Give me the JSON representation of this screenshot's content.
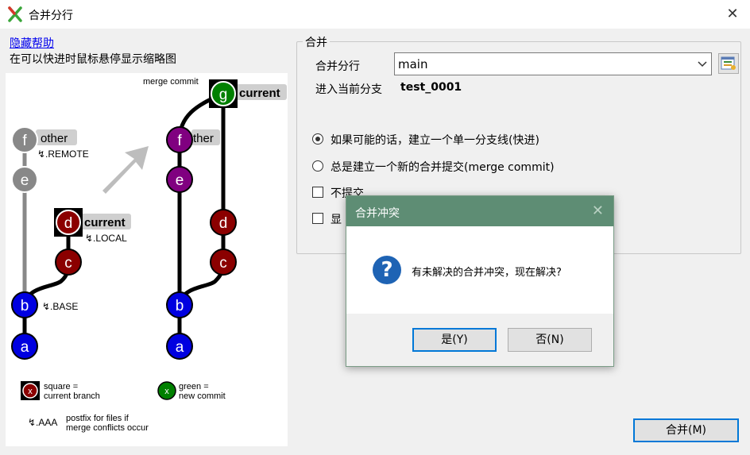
{
  "window": {
    "title": "合并分行",
    "close": "✕"
  },
  "help": {
    "hide_link": "隐藏帮助",
    "hint": "在可以快进时鼠标悬停显示缩略图"
  },
  "diagram": {
    "merge_commit_label": "merge commit",
    "commits_left": [
      "f",
      "e",
      "d",
      "c",
      "b",
      "a"
    ],
    "commits_right": [
      "g",
      "f",
      "e",
      "d",
      "c",
      "b",
      "a"
    ],
    "tag_other": "other",
    "tag_remote": "↯.REMOTE",
    "tag_current": "current",
    "tag_local": "↯.LOCAL",
    "tag_base": "↯.BASE",
    "tag_other_right": "ther",
    "legend_square_1": "square =",
    "legend_square_2": "current branch",
    "legend_green_1": "green =",
    "legend_green_2": "new commit",
    "legend_x": "x",
    "legend_aaa": "↯.AAA",
    "legend_postfix_1": "postfix for files if",
    "legend_postfix_2": "merge conflicts occur"
  },
  "merge": {
    "group_title": "合并",
    "branch_label": "合并分行",
    "branch_value": "main",
    "into_label": "进入当前分支",
    "into_value": "test_0001",
    "option_ff": "如果可能的话，建立一个单一分支线(快进)",
    "option_commit": "总是建立一个新的合并提交(merge commit)",
    "option_nocommit": "不提交",
    "option_show": "显",
    "merge_button": "合并(M)"
  },
  "dialog": {
    "title": "合并冲突",
    "close": "✕",
    "icon": "?",
    "message": "有未解决的合并冲突，现在解决?",
    "yes": "是(Y)",
    "no": "否(N)"
  },
  "colors": {
    "accent": "#0078d7",
    "dialog_header": "#5e8d74",
    "commit_gray": "#808080",
    "commit_red": "#8b0000",
    "commit_blue": "#0000e0",
    "commit_purple": "#800080",
    "commit_green": "#008000"
  }
}
